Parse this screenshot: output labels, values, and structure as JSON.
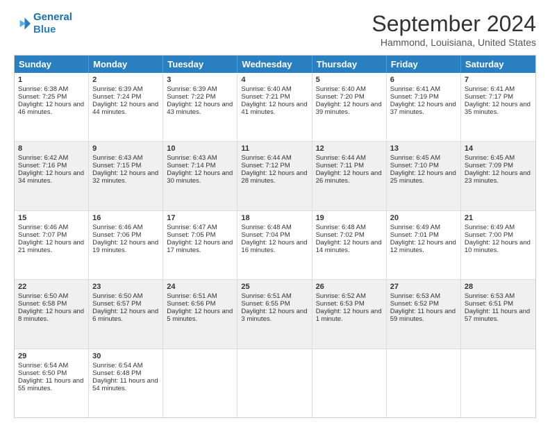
{
  "header": {
    "logo_line1": "General",
    "logo_line2": "Blue",
    "month_title": "September 2024",
    "location": "Hammond, Louisiana, United States"
  },
  "calendar": {
    "days_of_week": [
      "Sunday",
      "Monday",
      "Tuesday",
      "Wednesday",
      "Thursday",
      "Friday",
      "Saturday"
    ],
    "rows": [
      [
        null,
        {
          "day": "2",
          "sunrise": "Sunrise: 6:39 AM",
          "sunset": "Sunset: 7:24 PM",
          "daylight": "Daylight: 12 hours and 44 minutes."
        },
        {
          "day": "3",
          "sunrise": "Sunrise: 6:39 AM",
          "sunset": "Sunset: 7:22 PM",
          "daylight": "Daylight: 12 hours and 43 minutes."
        },
        {
          "day": "4",
          "sunrise": "Sunrise: 6:40 AM",
          "sunset": "Sunset: 7:21 PM",
          "daylight": "Daylight: 12 hours and 41 minutes."
        },
        {
          "day": "5",
          "sunrise": "Sunrise: 6:40 AM",
          "sunset": "Sunset: 7:20 PM",
          "daylight": "Daylight: 12 hours and 39 minutes."
        },
        {
          "day": "6",
          "sunrise": "Sunrise: 6:41 AM",
          "sunset": "Sunset: 7:19 PM",
          "daylight": "Daylight: 12 hours and 37 minutes."
        },
        {
          "day": "7",
          "sunrise": "Sunrise: 6:41 AM",
          "sunset": "Sunset: 7:17 PM",
          "daylight": "Daylight: 12 hours and 35 minutes."
        }
      ],
      [
        {
          "day": "1",
          "sunrise": "Sunrise: 6:38 AM",
          "sunset": "Sunset: 7:25 PM",
          "daylight": "Daylight: 12 hours and 46 minutes."
        },
        {
          "day": "9",
          "sunrise": "Sunrise: 6:43 AM",
          "sunset": "Sunset: 7:15 PM",
          "daylight": "Daylight: 12 hours and 32 minutes."
        },
        {
          "day": "10",
          "sunrise": "Sunrise: 6:43 AM",
          "sunset": "Sunset: 7:14 PM",
          "daylight": "Daylight: 12 hours and 30 minutes."
        },
        {
          "day": "11",
          "sunrise": "Sunrise: 6:44 AM",
          "sunset": "Sunset: 7:12 PM",
          "daylight": "Daylight: 12 hours and 28 minutes."
        },
        {
          "day": "12",
          "sunrise": "Sunrise: 6:44 AM",
          "sunset": "Sunset: 7:11 PM",
          "daylight": "Daylight: 12 hours and 26 minutes."
        },
        {
          "day": "13",
          "sunrise": "Sunrise: 6:45 AM",
          "sunset": "Sunset: 7:10 PM",
          "daylight": "Daylight: 12 hours and 25 minutes."
        },
        {
          "day": "14",
          "sunrise": "Sunrise: 6:45 AM",
          "sunset": "Sunset: 7:09 PM",
          "daylight": "Daylight: 12 hours and 23 minutes."
        }
      ],
      [
        {
          "day": "8",
          "sunrise": "Sunrise: 6:42 AM",
          "sunset": "Sunset: 7:16 PM",
          "daylight": "Daylight: 12 hours and 34 minutes."
        },
        {
          "day": "16",
          "sunrise": "Sunrise: 6:46 AM",
          "sunset": "Sunset: 7:06 PM",
          "daylight": "Daylight: 12 hours and 19 minutes."
        },
        {
          "day": "17",
          "sunrise": "Sunrise: 6:47 AM",
          "sunset": "Sunset: 7:05 PM",
          "daylight": "Daylight: 12 hours and 17 minutes."
        },
        {
          "day": "18",
          "sunrise": "Sunrise: 6:48 AM",
          "sunset": "Sunset: 7:04 PM",
          "daylight": "Daylight: 12 hours and 16 minutes."
        },
        {
          "day": "19",
          "sunrise": "Sunrise: 6:48 AM",
          "sunset": "Sunset: 7:02 PM",
          "daylight": "Daylight: 12 hours and 14 minutes."
        },
        {
          "day": "20",
          "sunrise": "Sunrise: 6:49 AM",
          "sunset": "Sunset: 7:01 PM",
          "daylight": "Daylight: 12 hours and 12 minutes."
        },
        {
          "day": "21",
          "sunrise": "Sunrise: 6:49 AM",
          "sunset": "Sunset: 7:00 PM",
          "daylight": "Daylight: 12 hours and 10 minutes."
        }
      ],
      [
        {
          "day": "15",
          "sunrise": "Sunrise: 6:46 AM",
          "sunset": "Sunset: 7:07 PM",
          "daylight": "Daylight: 12 hours and 21 minutes."
        },
        {
          "day": "23",
          "sunrise": "Sunrise: 6:50 AM",
          "sunset": "Sunset: 6:57 PM",
          "daylight": "Daylight: 12 hours and 6 minutes."
        },
        {
          "day": "24",
          "sunrise": "Sunrise: 6:51 AM",
          "sunset": "Sunset: 6:56 PM",
          "daylight": "Daylight: 12 hours and 5 minutes."
        },
        {
          "day": "25",
          "sunrise": "Sunrise: 6:51 AM",
          "sunset": "Sunset: 6:55 PM",
          "daylight": "Daylight: 12 hours and 3 minutes."
        },
        {
          "day": "26",
          "sunrise": "Sunrise: 6:52 AM",
          "sunset": "Sunset: 6:53 PM",
          "daylight": "Daylight: 12 hours and 1 minute."
        },
        {
          "day": "27",
          "sunrise": "Sunrise: 6:53 AM",
          "sunset": "Sunset: 6:52 PM",
          "daylight": "Daylight: 11 hours and 59 minutes."
        },
        {
          "day": "28",
          "sunrise": "Sunrise: 6:53 AM",
          "sunset": "Sunset: 6:51 PM",
          "daylight": "Daylight: 11 hours and 57 minutes."
        }
      ],
      [
        {
          "day": "22",
          "sunrise": "Sunrise: 6:50 AM",
          "sunset": "Sunset: 6:58 PM",
          "daylight": "Daylight: 12 hours and 8 minutes."
        },
        {
          "day": "30",
          "sunrise": "Sunrise: 6:54 AM",
          "sunset": "Sunset: 6:48 PM",
          "daylight": "Daylight: 11 hours and 54 minutes."
        },
        null,
        null,
        null,
        null,
        null
      ],
      [
        {
          "day": "29",
          "sunrise": "Sunrise: 6:54 AM",
          "sunset": "Sunset: 6:50 PM",
          "daylight": "Daylight: 11 hours and 55 minutes."
        },
        null,
        null,
        null,
        null,
        null,
        null
      ]
    ],
    "row_order": [
      [
        null,
        "2",
        "3",
        "4",
        "5",
        "6",
        "7"
      ],
      [
        "1",
        "9",
        "10",
        "11",
        "12",
        "13",
        "14"
      ],
      [
        "8",
        "16",
        "17",
        "18",
        "19",
        "20",
        "21"
      ],
      [
        "15",
        "23",
        "24",
        "25",
        "26",
        "27",
        "28"
      ],
      [
        "22",
        "30",
        null,
        null,
        null,
        null,
        null
      ],
      [
        "29",
        null,
        null,
        null,
        null,
        null,
        null
      ]
    ]
  }
}
